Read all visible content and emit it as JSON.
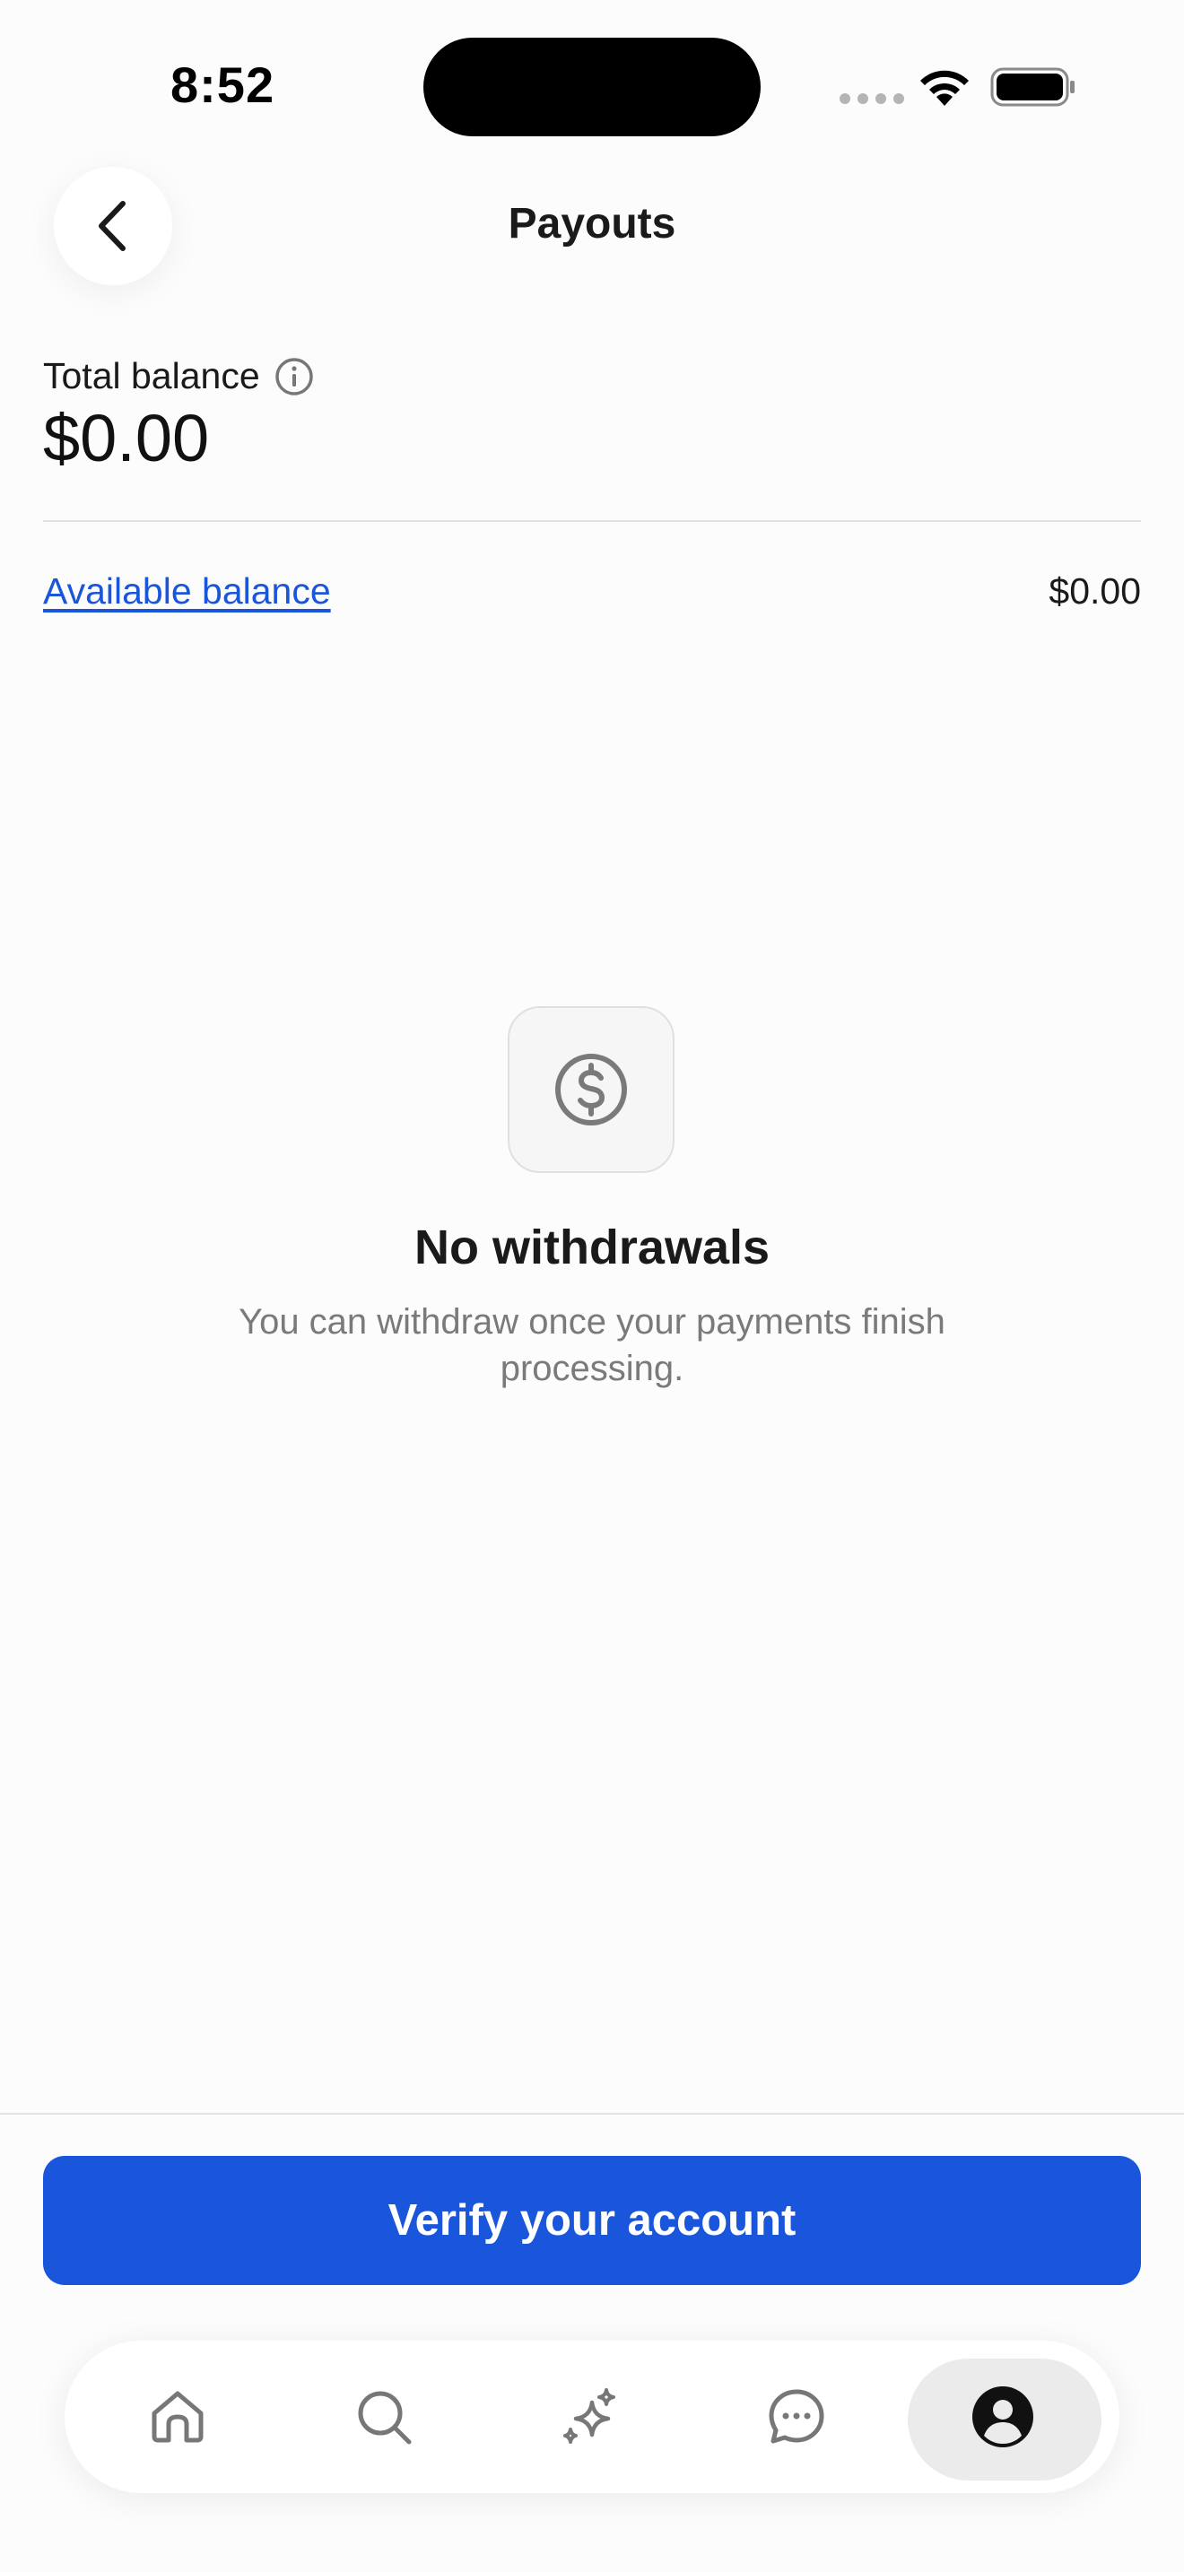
{
  "status_bar": {
    "time": "8:52"
  },
  "header": {
    "title": "Payouts",
    "back_icon": "chevron-left-icon"
  },
  "balance": {
    "total_label": "Total balance",
    "total_amount": "$0.00",
    "available_label": "Available balance",
    "available_amount": "$0.00"
  },
  "empty_state": {
    "icon": "dollar-circle-icon",
    "title": "No withdrawals",
    "description": "You can withdraw once your payments finish processing."
  },
  "actions": {
    "verify_label": "Verify your account"
  },
  "tab_bar": {
    "tabs": [
      {
        "icon": "home-icon",
        "active": false
      },
      {
        "icon": "search-icon",
        "active": false
      },
      {
        "icon": "sparkle-icon",
        "active": false
      },
      {
        "icon": "chat-icon",
        "active": false
      },
      {
        "icon": "profile-icon",
        "active": true
      }
    ]
  },
  "colors": {
    "accent": "#1a56db",
    "background": "#fcfcfc",
    "muted_text": "#7a7a7a"
  }
}
